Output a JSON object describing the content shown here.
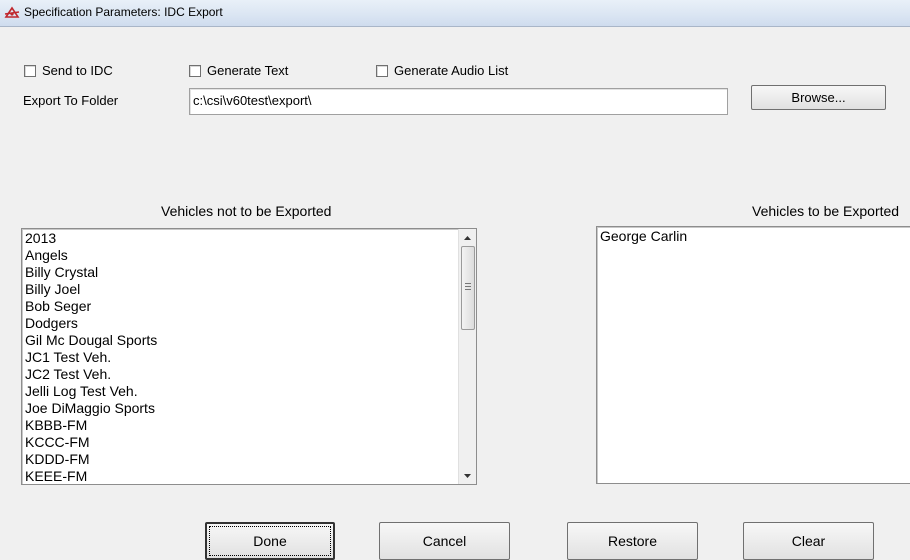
{
  "window": {
    "title": "Specification Parameters: IDC Export"
  },
  "options": {
    "send_to_idc": "Send to IDC",
    "generate_text": "Generate Text",
    "generate_audio_list": "Generate Audio List"
  },
  "export_folder": {
    "label": "Export To Folder",
    "value": "c:\\csi\\v60test\\export\\",
    "browse_label": "Browse..."
  },
  "lists": {
    "not_exported": {
      "header": "Vehicles not to be Exported",
      "items": [
        "2013",
        "Angels",
        "Billy Crystal",
        "Billy Joel",
        "Bob Seger",
        "Dodgers",
        "Gil Mc Dougal Sports",
        "JC1 Test Veh.",
        "JC2 Test Veh.",
        "Jelli Log Test Veh.",
        "Joe DiMaggio Sports",
        "KBBB-FM",
        "KCCC-FM",
        "KDDD-FM",
        "KEEE-FM"
      ]
    },
    "exported": {
      "header": "Vehicles to be Exported",
      "items": [
        "George Carlin"
      ]
    }
  },
  "buttons": {
    "done": "Done",
    "cancel": "Cancel",
    "restore": "Restore",
    "clear": "Clear"
  }
}
